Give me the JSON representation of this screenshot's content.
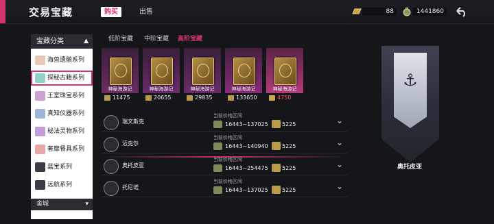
{
  "header": {
    "title": "交易宝藏",
    "tabs": [
      {
        "label": "购买",
        "active": true
      },
      {
        "label": "出售",
        "active": false
      }
    ],
    "resources": [
      {
        "icon": "gold-bar-icon",
        "value": "88"
      },
      {
        "icon": "coin-bag-icon",
        "value": "1441860"
      }
    ]
  },
  "sidebar": {
    "header": "宝藏分类",
    "items": [
      {
        "label": "海兽遗骸系列",
        "icon": "bone-icon"
      },
      {
        "label": "探秘古籍系列",
        "icon": "scroll-icon",
        "selected": true
      },
      {
        "label": "王室珠宝系列",
        "icon": "jewel-icon"
      },
      {
        "label": "真知仪器系列",
        "icon": "compass-icon"
      },
      {
        "label": "秘法灵物系列",
        "icon": "orb-icon"
      },
      {
        "label": "奢靡餐具系列",
        "icon": "tableware-icon"
      },
      {
        "label": "蓝宝系列",
        "icon": "blue-gem-icon"
      },
      {
        "label": "远航系列",
        "icon": "ship-icon"
      }
    ],
    "footer": "舍城"
  },
  "subtabs": [
    {
      "label": "低阶宝藏",
      "active": false
    },
    {
      "label": "中阶宝藏",
      "active": false
    },
    {
      "label": "高阶宝藏",
      "active": true
    }
  ],
  "cards": [
    {
      "name": "神秘海游记",
      "price": "11475",
      "bg": "#6d2e63"
    },
    {
      "name": "神秘海游记",
      "price": "20655",
      "bg": "#6a2a6b"
    },
    {
      "name": "神秘海游记",
      "price": "29835",
      "bg": "#6b2b6a"
    },
    {
      "name": "神秘海游记",
      "price": "133650",
      "bg": "#8a2b76"
    },
    {
      "name": "神秘海游记",
      "price": "4750",
      "bg": "#b23c7a",
      "red": true
    }
  ],
  "rows": [
    {
      "name": "瑞文斯克",
      "range_label": "当前价格区间",
      "range": "16443~137025",
      "gold": "5225"
    },
    {
      "name": "迈克尔",
      "range_label": "当前价格区间",
      "range": "16443~140940",
      "gold": "5225"
    },
    {
      "name": "奥托皮亚",
      "range_label": "当前价格区间",
      "range": "16443~254475",
      "gold": "5225"
    },
    {
      "name": "托尼诺",
      "range_label": "当前价格区间",
      "range": "16443~137025",
      "gold": "5225"
    }
  ],
  "detail": {
    "name": "奥托皮亚"
  }
}
